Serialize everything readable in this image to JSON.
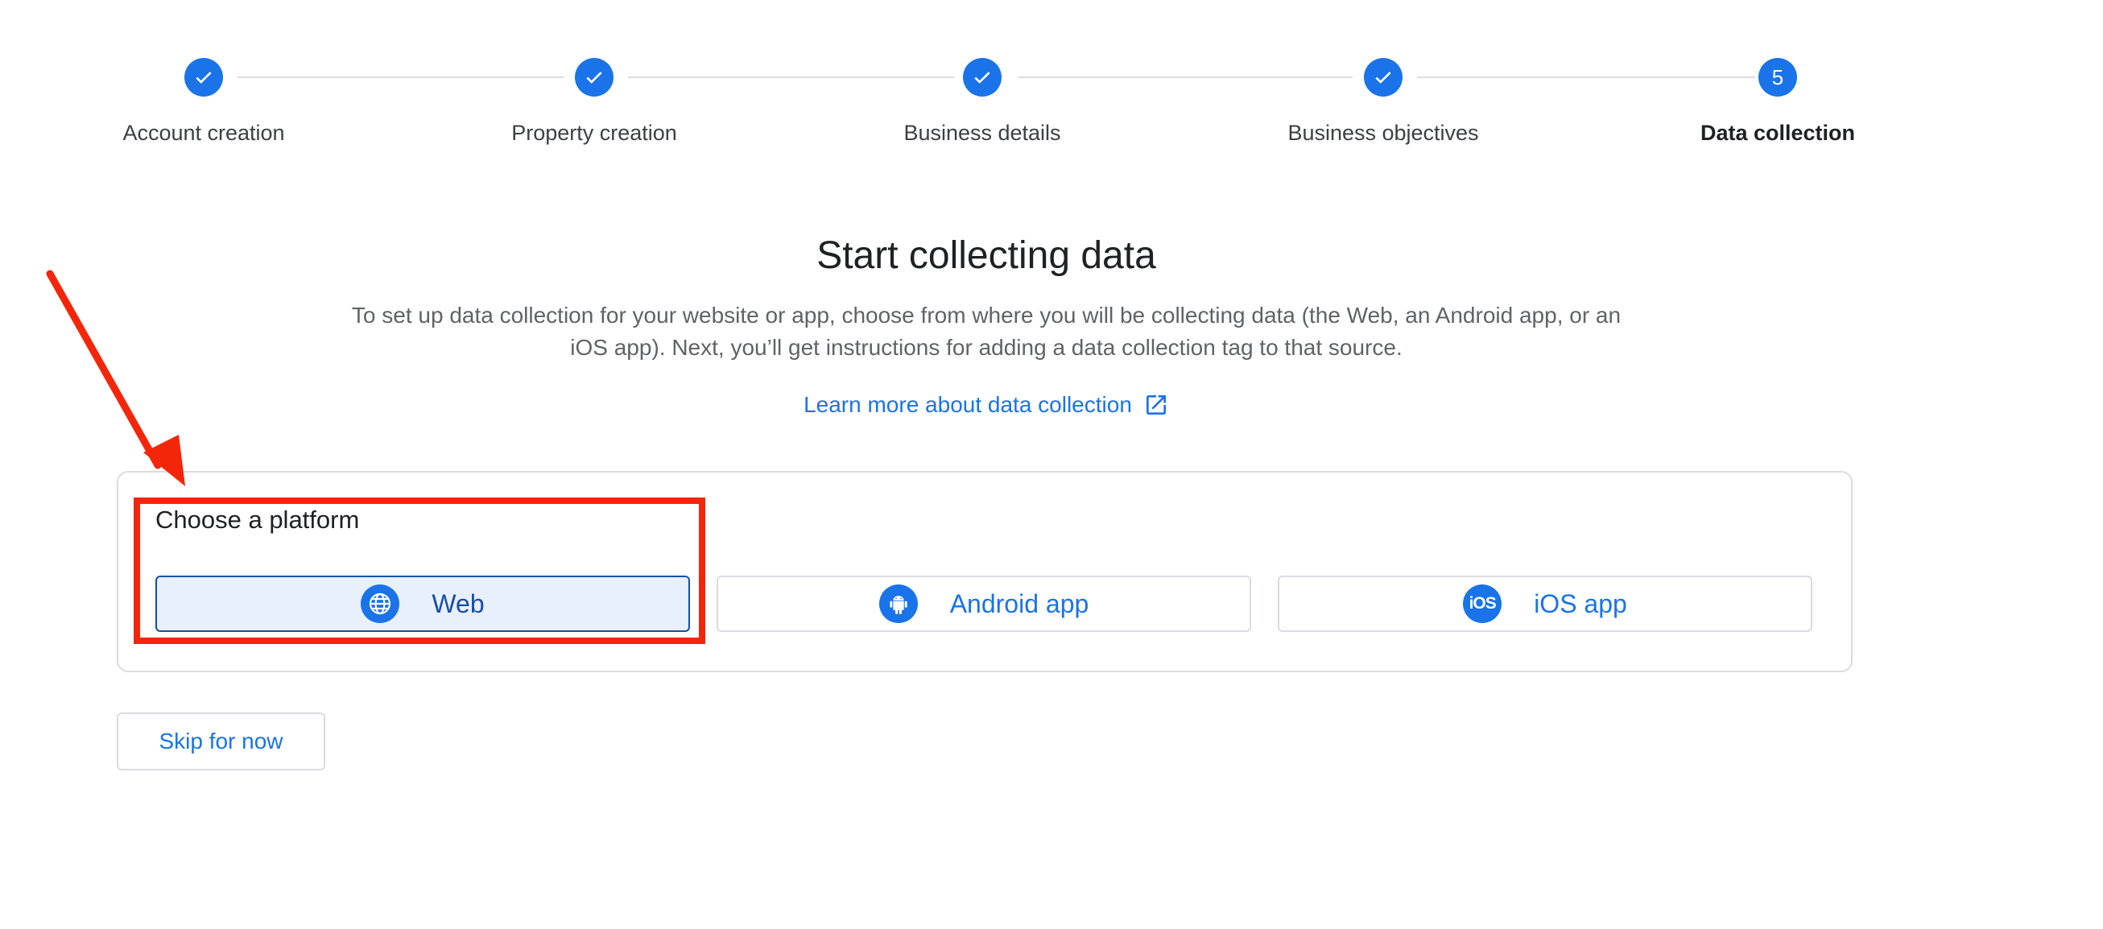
{
  "stepper": {
    "steps": [
      {
        "label": "Account creation",
        "status": "completed"
      },
      {
        "label": "Property creation",
        "status": "completed"
      },
      {
        "label": "Business details",
        "status": "completed"
      },
      {
        "label": "Business objectives",
        "status": "completed"
      },
      {
        "label": "Data collection",
        "status": "current",
        "number": "5"
      }
    ],
    "colors": {
      "accent": "#1a73e8",
      "line": "#dadce0"
    }
  },
  "main": {
    "title": "Start collecting data",
    "description": "To set up data collection for your website or app, choose from where you will be collecting data (the Web, an Android app, or an iOS app). Next, you’ll get instructions for adding a data collection tag to that source.",
    "learn_more": {
      "label": "Learn more about data collection",
      "icon": "open-in-new-icon"
    }
  },
  "platform": {
    "title": "Choose a platform",
    "options": [
      {
        "label": "Web",
        "icon": "globe-icon",
        "selected": true
      },
      {
        "label": "Android app",
        "icon": "android-icon",
        "selected": false
      },
      {
        "label": "iOS app",
        "icon": "ios-icon",
        "icon_text": "iOS",
        "selected": false
      }
    ]
  },
  "actions": {
    "skip_label": "Skip for now"
  },
  "annotation": {
    "color": "#f4260a"
  }
}
